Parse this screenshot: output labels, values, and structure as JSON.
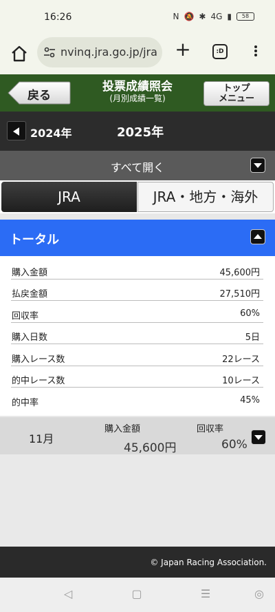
{
  "status": {
    "time": "16:26",
    "network": "4G",
    "battery": "58"
  },
  "browser": {
    "url": "nvinq.jra.go.jp/jra",
    "tabs_label": ":D"
  },
  "header": {
    "back_label": "戻る",
    "title": "投票成績照会",
    "subtitle": "(月別成績一覧)",
    "top_menu_line1": "トップ",
    "top_menu_line2": "メニュー"
  },
  "years": {
    "prev": "2024年",
    "current": "2025年"
  },
  "open_all": "すべて開く",
  "tabs": {
    "jra": "JRA",
    "other": "JRA・地方・海外"
  },
  "total": {
    "label": "トータル",
    "rows": [
      {
        "label": "購入金額",
        "value": "45,600円"
      },
      {
        "label": "払戻金額",
        "value": "27,510円"
      },
      {
        "label": "回収率",
        "value": "60%"
      },
      {
        "label": "購入日数",
        "value": "5日"
      },
      {
        "label": "購入レース数",
        "value": "22レース"
      },
      {
        "label": "的中レース数",
        "value": "10レース"
      },
      {
        "label": "的中率",
        "value": "45%"
      }
    ]
  },
  "months": [
    {
      "month": "11月",
      "purchase_header": "購入金額",
      "purchase": "45,600円",
      "return_header": "回収率",
      "return_rate": "60%"
    }
  ],
  "footer": "© Japan Racing Association."
}
